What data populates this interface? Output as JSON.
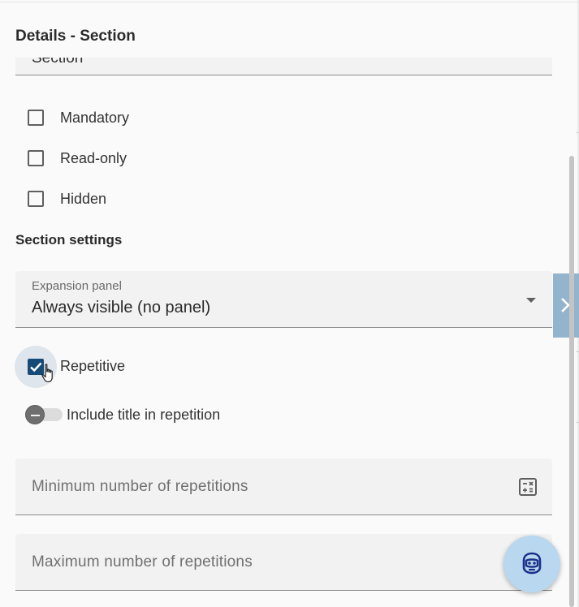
{
  "panel": {
    "title": "Details - Section",
    "section_field_value": "Section"
  },
  "checkboxes": [
    {
      "label": "Mandatory",
      "checked": false
    },
    {
      "label": "Read-only",
      "checked": false
    },
    {
      "label": "Hidden",
      "checked": false
    }
  ],
  "section_settings": {
    "heading": "Section settings",
    "expansion_panel": {
      "label": "Expansion panel",
      "value": "Always visible (no panel)",
      "icon": "chevron-down-icon"
    },
    "repetitive": {
      "label": "Repetitive",
      "checked": true
    },
    "include_title": {
      "label": "Include title in repetition",
      "on": false
    },
    "min_repetitions": {
      "placeholder": "Minimum number of repetitions",
      "icon": "calculator-icon"
    },
    "max_repetitions": {
      "placeholder": "Maximum number of repetitions"
    }
  },
  "side_toggle": {
    "icon": "chevron-right-icon"
  },
  "assistant_button": {
    "icon": "robot-assistant-icon"
  },
  "colors": {
    "accent": "#174b77",
    "side_toggle": "#93b4cc",
    "fab": "#b9d7ee",
    "field_bg": "#f2f2f2"
  }
}
